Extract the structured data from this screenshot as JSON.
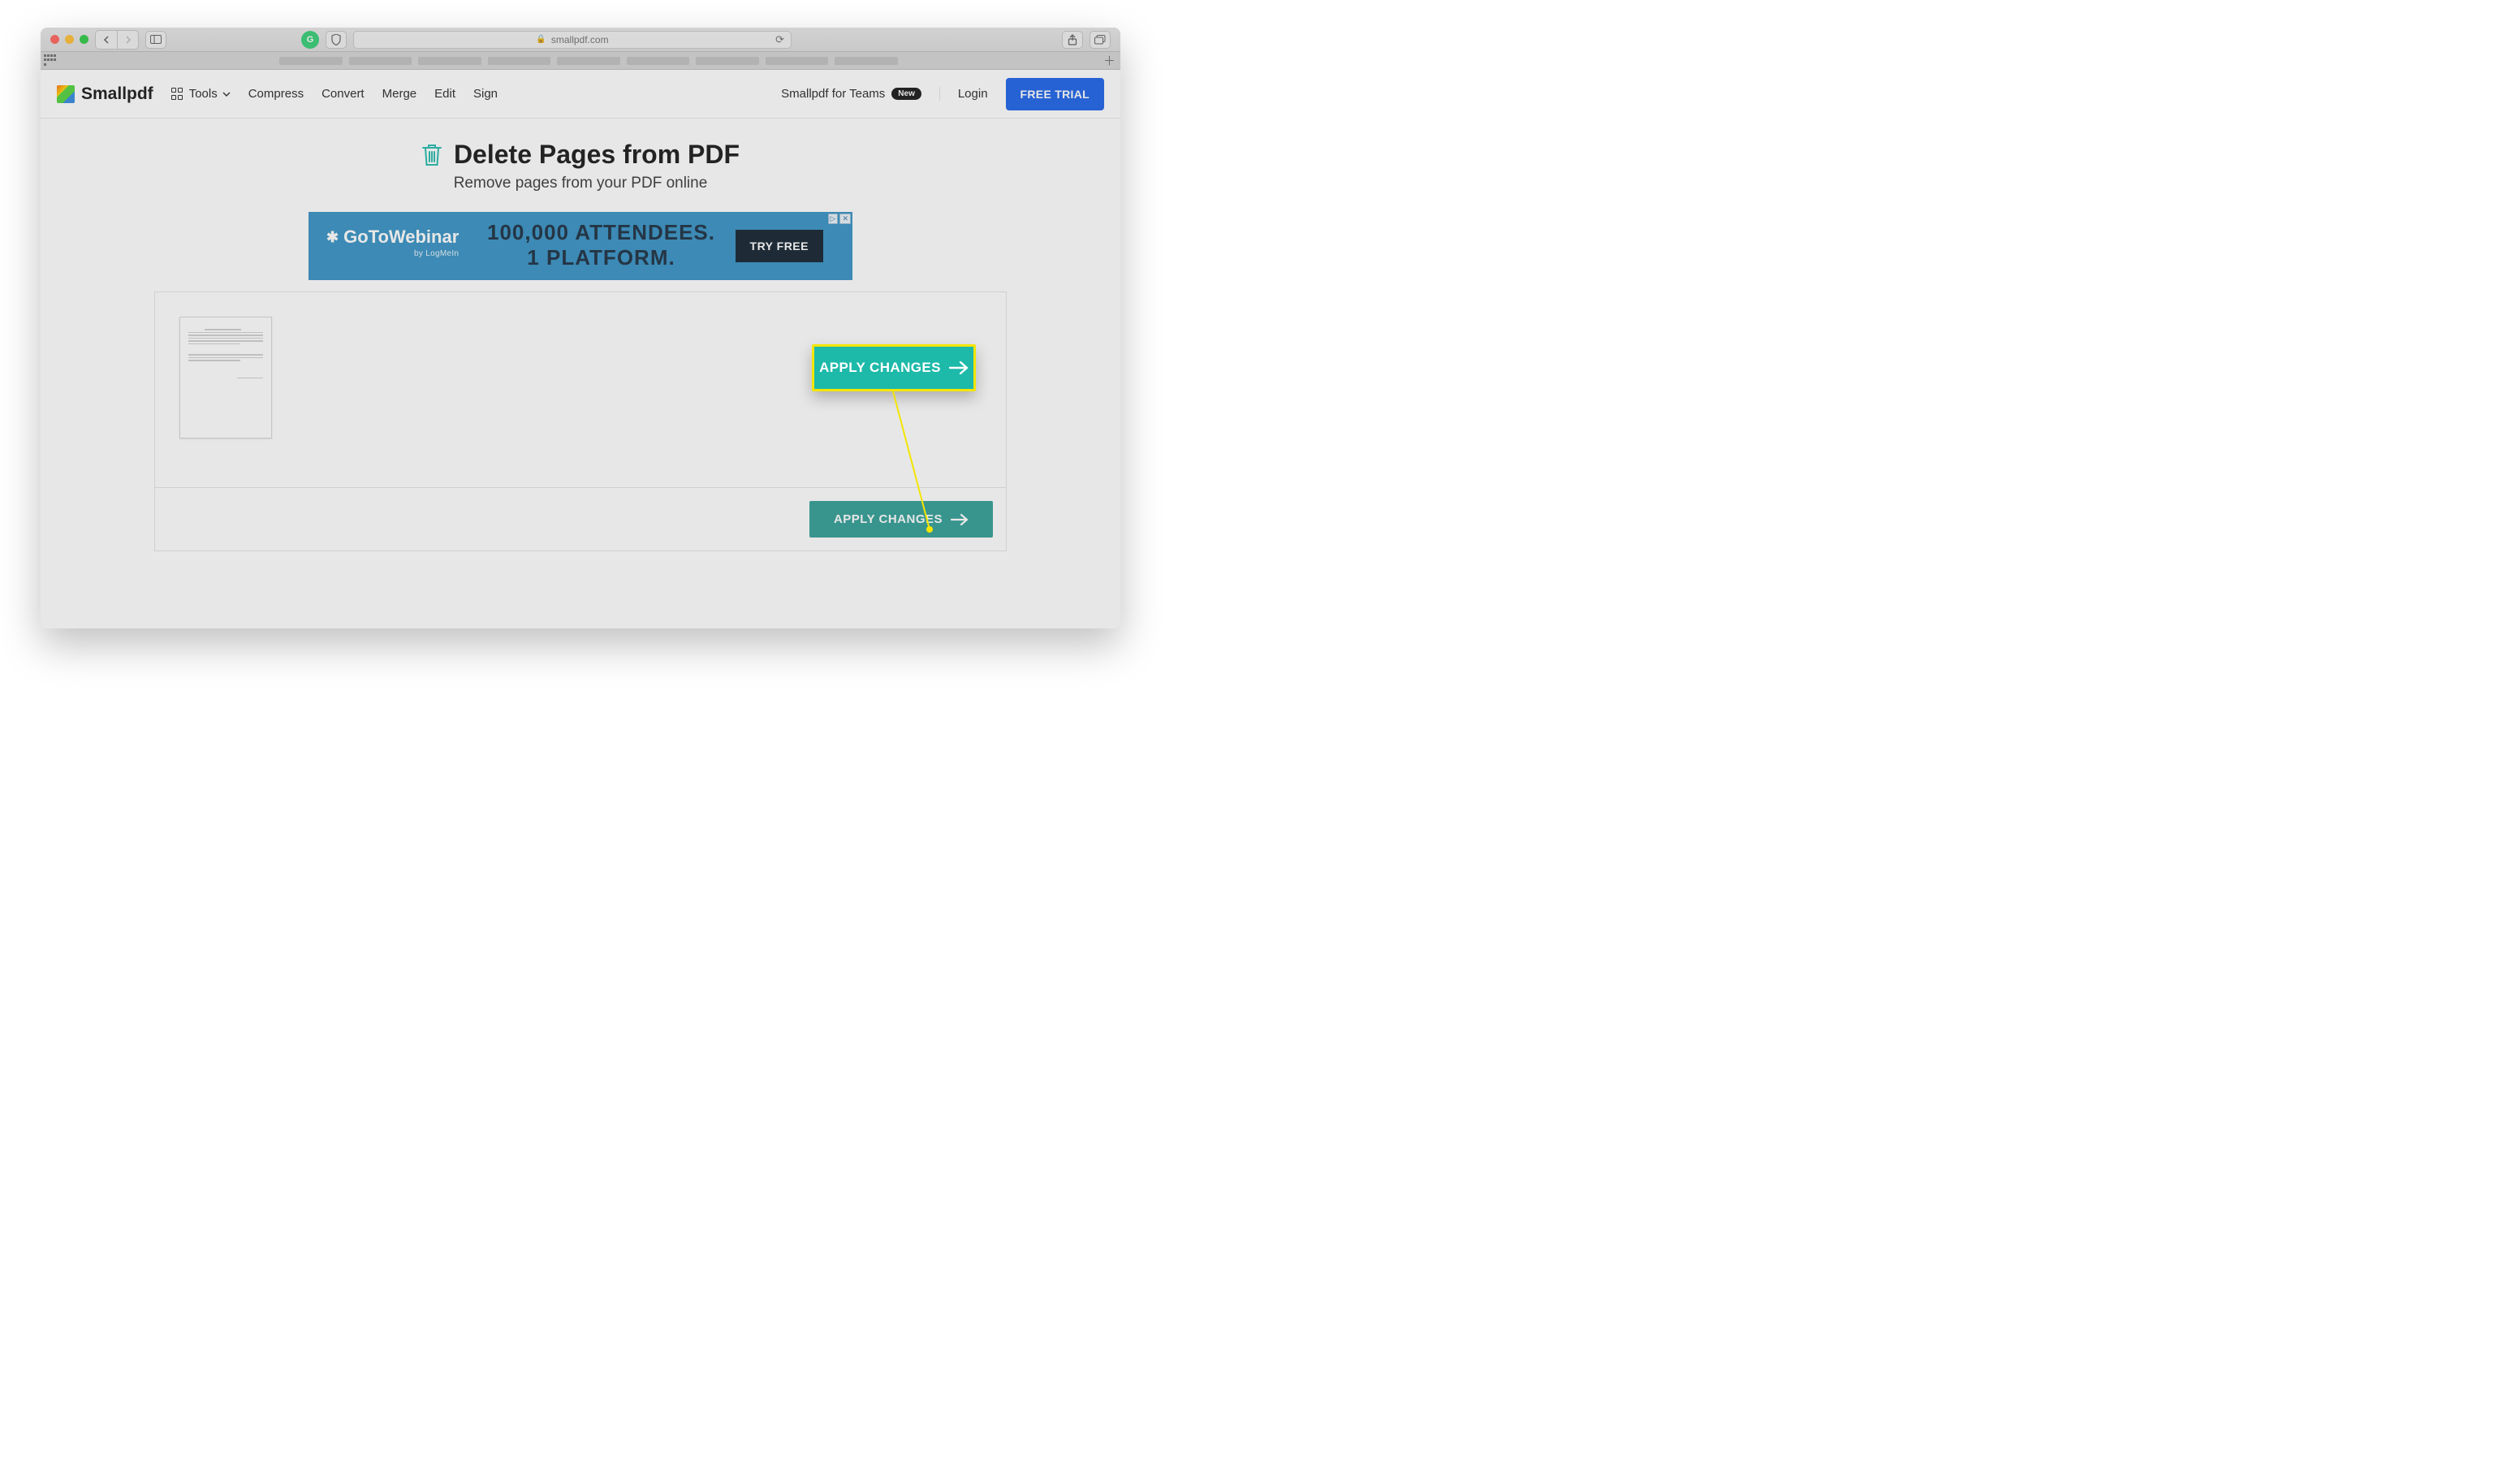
{
  "browser": {
    "url_host": "smallpdf.com"
  },
  "header": {
    "brand": "Smallpdf",
    "tools_label": "Tools",
    "nav": {
      "compress": "Compress",
      "convert": "Convert",
      "merge": "Merge",
      "edit": "Edit",
      "sign": "Sign"
    },
    "teams_label": "Smallpdf for Teams",
    "teams_badge": "New",
    "login": "Login",
    "trial": "FREE TRIAL"
  },
  "page": {
    "title": "Delete Pages from PDF",
    "subtitle": "Remove pages from your PDF online"
  },
  "ad": {
    "brand": "GoToWebinar",
    "byline": "by LogMeIn",
    "line1": "100,000 ATTENDEES.",
    "line2": "1 PLATFORM.",
    "cta": "TRY FREE",
    "info_icon": "▷",
    "close_icon": "✕"
  },
  "tool": {
    "apply_label": "APPLY CHANGES"
  },
  "callout": {
    "label": "APPLY CHANGES"
  }
}
